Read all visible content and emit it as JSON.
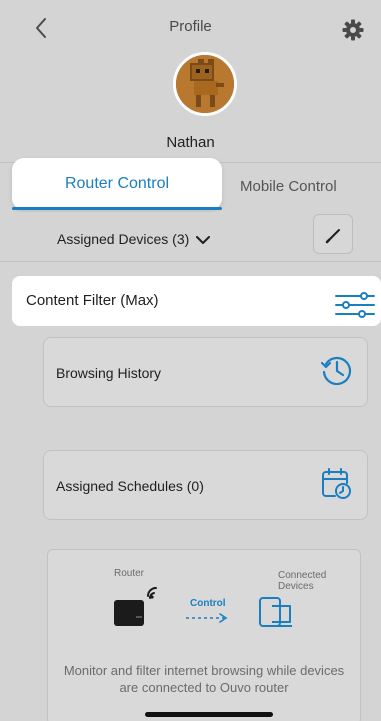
{
  "header": {
    "title": "Profile",
    "back_icon": "chevron-left-icon",
    "settings_icon": "gear-icon"
  },
  "profile": {
    "name": "Nathan",
    "avatar": "cat-avatar"
  },
  "tabs": {
    "router_label": "Router Control",
    "mobile_label": "Mobile Control",
    "active": "Router Control"
  },
  "assigned": {
    "label": "Assigned Devices (3)",
    "edit_icon": "pencil-icon"
  },
  "content_filter": {
    "label": "Content Filter (Max)",
    "icon": "sliders-icon"
  },
  "browsing_history": {
    "label": "Browsing History",
    "icon": "history-icon"
  },
  "schedules": {
    "label": "Assigned Schedules (0)",
    "icon": "calendar-clock-icon"
  },
  "info": {
    "router_label": "Router",
    "devices_label": "Connected Devices",
    "control_label": "Control",
    "description": "Monitor and filter internet browsing while devices are connected to Ouvo router"
  },
  "colors": {
    "accent": "#1a7fc1",
    "background": "#d4d4d4",
    "highlight": "#ffffff"
  }
}
